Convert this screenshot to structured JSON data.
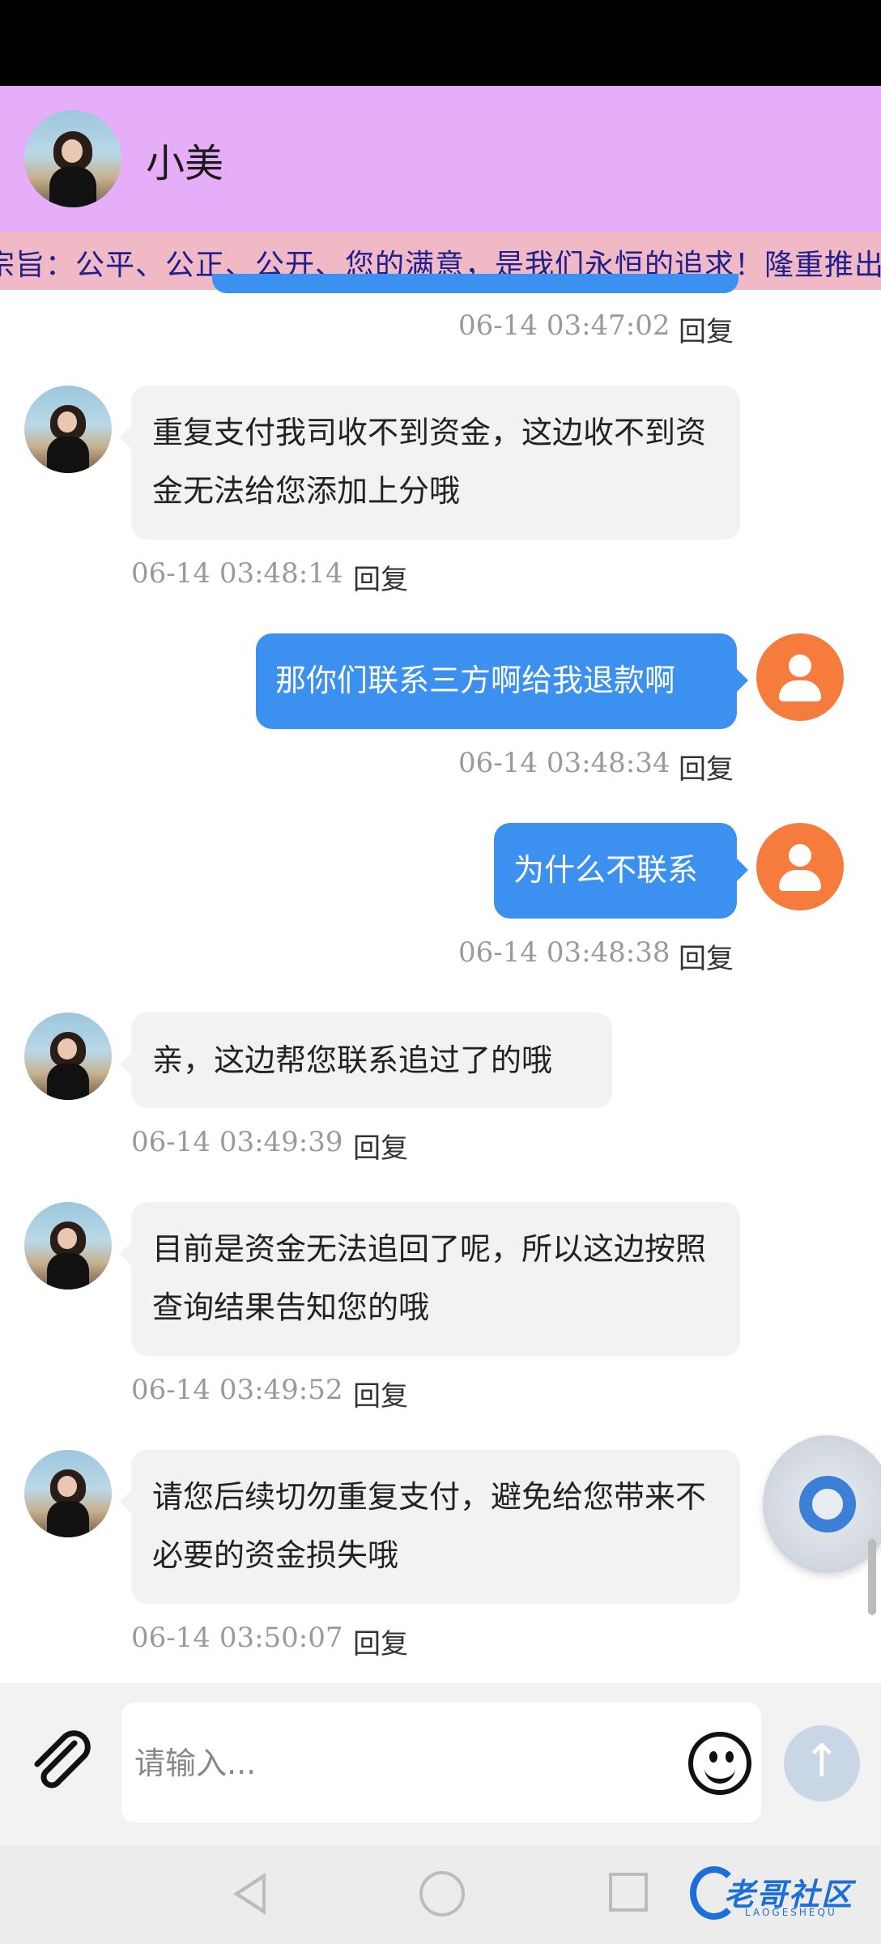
{
  "header": {
    "title": "小美"
  },
  "marquee": {
    "text": "宗旨：公平、公正、公开、您的满意，是我们永恒的追求！隆重推出"
  },
  "messages": [
    {
      "side": "out",
      "time": "06-14 03:47:02",
      "reply": "回复"
    },
    {
      "side": "in",
      "text": "重复支付我司收不到资金，这边收不到资金无法给您添加上分哦",
      "time": "06-14 03:48:14",
      "reply": "回复"
    },
    {
      "side": "out",
      "text": "那你们联系三方啊给我退款啊",
      "time": "06-14 03:48:34",
      "reply": "回复"
    },
    {
      "side": "out",
      "text": "为什么不联系",
      "time": "06-14 03:48:38",
      "reply": "回复"
    },
    {
      "side": "in",
      "text": "亲，这边帮您联系追过了的哦",
      "time": "06-14 03:49:39",
      "reply": "回复"
    },
    {
      "side": "in",
      "text": "目前是资金无法追回了呢，所以这边按照查询结果告知您的哦",
      "time": "06-14 03:49:52",
      "reply": "回复"
    },
    {
      "side": "in",
      "text": "请您后续切勿重复支付，避免给您带来不必要的资金损失哦",
      "time": "06-14 03:50:07",
      "reply": "回复"
    }
  ],
  "input": {
    "placeholder": "请输入...",
    "value": ""
  },
  "watermark": {
    "text": "老哥社区",
    "sub": "LAOGESHEQU"
  },
  "colors": {
    "header": "#e6aef8",
    "marquee": "#f1b9c6",
    "outgoing": "#3b90f0",
    "user_avatar": "#f67c3e"
  }
}
